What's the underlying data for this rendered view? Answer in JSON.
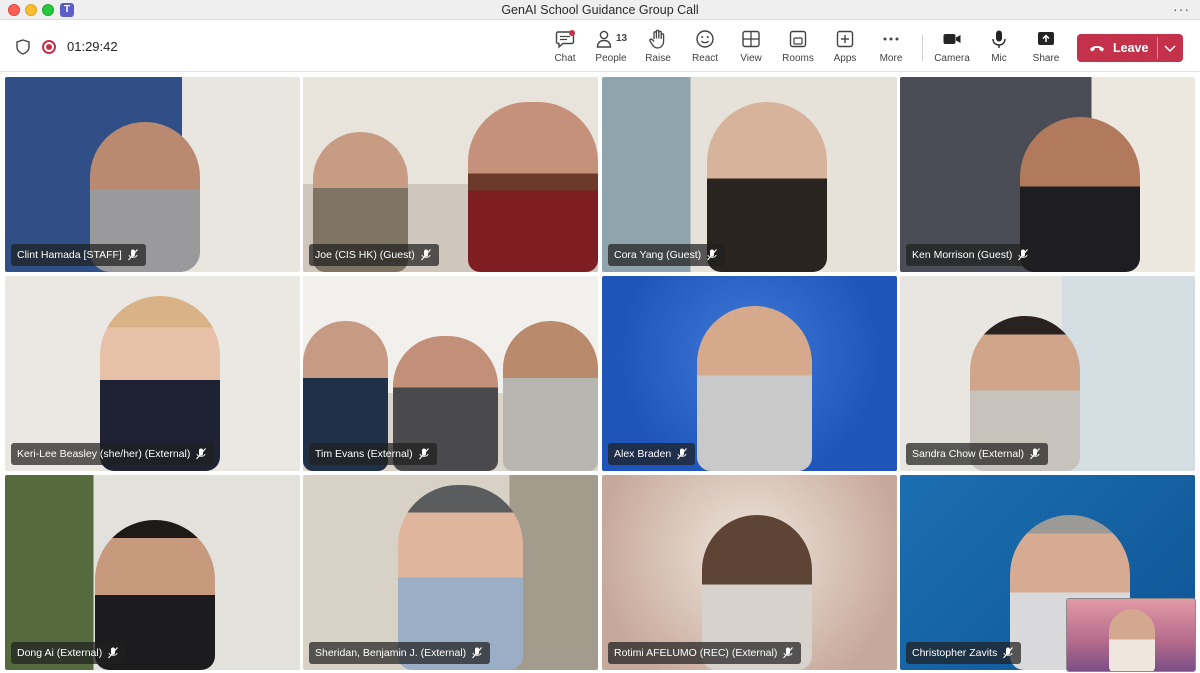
{
  "window": {
    "title": "GenAI School Guidance Group Call",
    "more": "···"
  },
  "toolbar": {
    "timer": "01:29:42",
    "tools": {
      "chat": "Chat",
      "people": "People",
      "people_count": "13",
      "raise": "Raise",
      "react": "React",
      "view": "View",
      "rooms": "Rooms",
      "apps": "Apps",
      "more": "More",
      "camera": "Camera",
      "mic": "Mic",
      "share": "Share"
    },
    "leave": "Leave"
  },
  "participants": [
    {
      "name": "Clint Hamada [STAFF]"
    },
    {
      "name": "Joe (CIS HK) (Guest)"
    },
    {
      "name": "Cora Yang (Guest)"
    },
    {
      "name": "Ken Morrison (Guest)"
    },
    {
      "name": "Keri-Lee Beasley (she/her) (External)"
    },
    {
      "name": "Tim Evans (External)"
    },
    {
      "name": "Alex Braden"
    },
    {
      "name": "Sandra Chow (External)"
    },
    {
      "name": "Dong Ai (External)"
    },
    {
      "name": "Sheridan, Benjamin J. (External)"
    },
    {
      "name": "Rotimi AFELUMO (REC) (External)"
    },
    {
      "name": "Christopher Zavits"
    }
  ],
  "colors": {
    "leave": "#c4314b",
    "recording": "#c4314b",
    "teams": "#5b5fc7"
  }
}
